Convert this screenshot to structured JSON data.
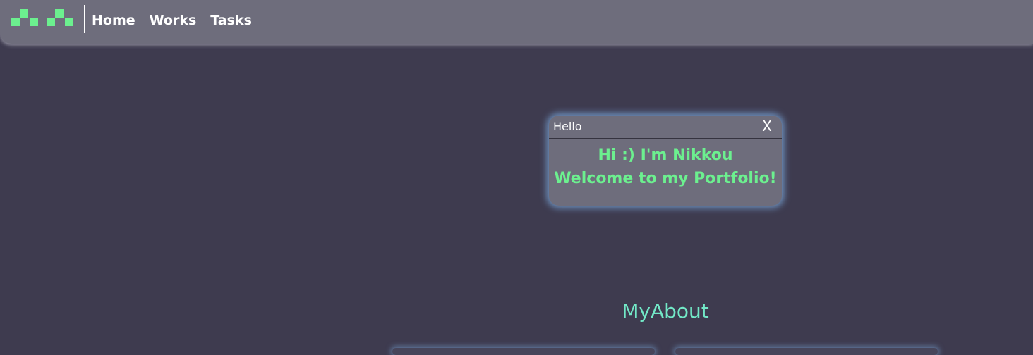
{
  "navbar": {
    "logo_icon": "pixel-logo-icon",
    "logo_color": "#6cf08f",
    "links": [
      {
        "label": "Home"
      },
      {
        "label": "Works"
      },
      {
        "label": "Tasks"
      }
    ]
  },
  "dialog": {
    "title": "Hello",
    "close_label": "X",
    "line1": "Hi :) I'm Nikkou",
    "line2": "Welcome to my Portfolio!"
  },
  "section": {
    "title": "MyAbout"
  },
  "colors": {
    "background": "#3e3b4f",
    "panel": "#6e6d7c",
    "accent_green": "#6cf08f",
    "accent_teal": "#72e8c7",
    "glow": "#82b4eb"
  }
}
